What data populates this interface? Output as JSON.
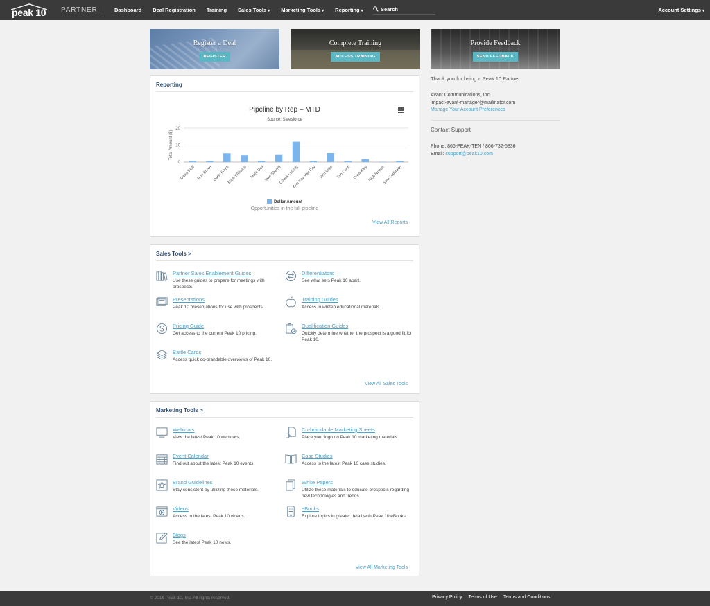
{
  "navbar": {
    "logo": "peak 10",
    "brand_sub": "PARTNER",
    "items": [
      {
        "label": "Dashboard"
      },
      {
        "label": "Deal Registration"
      },
      {
        "label": "Training"
      },
      {
        "label": "Sales Tools"
      },
      {
        "label": "Marketing Tools"
      },
      {
        "label": "Reporting"
      }
    ],
    "search_label": "Search",
    "account_label": "Account Settings",
    "caret": "▾"
  },
  "banners": [
    {
      "title": "Register a Deal",
      "button": "REGISTER"
    },
    {
      "title": "Complete Training",
      "button": "ACCESS TRAINING"
    },
    {
      "title": "Provide Feedback",
      "button": "SEND FEEDBACK"
    }
  ],
  "reporting": {
    "heading": "Reporting",
    "legend_label": "Dollar Amount",
    "caption": "Opportunities in the full pipeline",
    "view_all": "View All Reports"
  },
  "chart_data": {
    "type": "bar",
    "title": "Pipeline by Rep – MTD",
    "subtitle": "Source: Salesforce",
    "ylabel": "Total Amount ($)",
    "xlabel": "",
    "ylim": [
      0,
      20
    ],
    "yticks": [
      0,
      10,
      20
    ],
    "categories": [
      "Dana Wolf",
      "Ron Burke",
      "Darin Frank",
      "Mark Williams",
      "Mark Diol",
      "Jake Sherrill",
      "Chuck Ludwig",
      "Erin Kay Van Pay",
      "Tom Vaile",
      "Tim Conti",
      "Drew Kley",
      "Rich Nowak",
      "Sam Galbraith"
    ],
    "series": [
      {
        "name": "Dollar Amount",
        "values": [
          0.8,
          0.8,
          5.2,
          4.0,
          0.8,
          4.2,
          12.0,
          0.8,
          5.3,
          0.8,
          1.8,
          0.1,
          0.8
        ]
      }
    ],
    "legend": "bottom-center",
    "grid": true,
    "color": "#7cb5ec"
  },
  "sales_tools": {
    "heading": "Sales Tools >",
    "view_all": "View All Sales Tools",
    "items": [
      {
        "icon": "books-icon",
        "title": "Partner Sales Enablement Guides",
        "desc": "Use these guides to prepare for meetings with prospects."
      },
      {
        "icon": "arrows-circle-icon",
        "title": "Differentiators",
        "desc": "See what sets Peak 10 apart."
      },
      {
        "icon": "presentation-icon",
        "title": "Presentations",
        "desc": "Peak 10 presentations for use with prospects."
      },
      {
        "icon": "apple-icon",
        "title": "Training Guides",
        "desc": "Access to written educational materials."
      },
      {
        "icon": "dollar-circle-icon",
        "title": "Pricing Guide",
        "desc": "Get access to the current Peak 10 pricing."
      },
      {
        "icon": "clipboard-check-icon",
        "title": "Qualification Guides",
        "desc": "Quickly determine whether the prospect is a good fit for Peak 10."
      },
      {
        "icon": "layers-icon",
        "title": "Battle Cards",
        "desc": "Access quick co-brandable overviews of Peak 10."
      }
    ]
  },
  "marketing_tools": {
    "heading": "Marketing Tools >",
    "view_all": "View All Marketing Tools",
    "items": [
      {
        "icon": "monitor-icon",
        "title": "Webinars",
        "desc": "View the latest Peak 10 webinars."
      },
      {
        "icon": "document-hand-icon",
        "title": "Co-brandable Marketing Sheets",
        "desc": "Place your logo on Peak 10 marketing materials."
      },
      {
        "icon": "calendar-icon",
        "title": "Event Calendar",
        "desc": "Find out about the latest Peak 10 events."
      },
      {
        "icon": "open-book-icon",
        "title": "Case Studies",
        "desc": "Access to the latest Peak 10 case studies."
      },
      {
        "icon": "star-frame-icon",
        "title": "Brand Guidelines",
        "desc": "Stay consistent by utilizing these materials."
      },
      {
        "icon": "papers-icon",
        "title": "White Papers",
        "desc": "Utilize these materials to educate prospects regarding new technologies and trends."
      },
      {
        "icon": "video-icon",
        "title": "Videos",
        "desc": "Access to the latest Peak 10 videos."
      },
      {
        "icon": "ebook-icon",
        "title": "eBooks",
        "desc": "Explore topics in greater detail with Peak 10 eBooks."
      },
      {
        "icon": "pencil-note-icon",
        "title": "Blogs",
        "desc": "See the latest Peak 10 news."
      }
    ]
  },
  "sidebar": {
    "thanks": "Thank you for being a Peak 10 Partner.",
    "company": "Avant Communications, Inc.",
    "email": "impact-avant-manager@mailinator.com",
    "manage_link": "Manage Your Account Preferences",
    "support_heading": "Contact Support",
    "phone": "Phone: 866-PEAK-TEN / 866-732-5836",
    "support_email_label": "Email:",
    "support_email": "support@peak10.com"
  },
  "footer": {
    "copyright": "© 2016 Peak 10, Inc. All rights reserved.",
    "links": [
      "Privacy Policy",
      "Terms of Use",
      "Terms and Conditions"
    ]
  }
}
